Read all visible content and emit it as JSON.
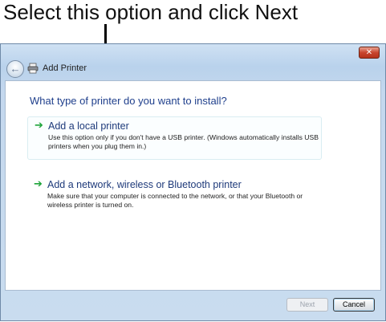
{
  "caption": "Select this option and click Next",
  "window": {
    "title": "Add Printer",
    "icons": {
      "back": "back-arrow-icon",
      "printer": "printer-icon",
      "close": "close-icon"
    }
  },
  "content": {
    "heading": "What type of printer do you want to install?",
    "options": [
      {
        "title": "Add a local printer",
        "description": "Use this option only if you don't have a USB printer. (Windows automatically installs USB printers when you plug them in.)",
        "icon": "green-arrow-icon"
      },
      {
        "title": "Add a network, wireless or Bluetooth printer",
        "description": "Make sure that your computer is connected to the network, or that your Bluetooth or wireless printer is turned on.",
        "icon": "green-arrow-icon"
      }
    ]
  },
  "buttons": {
    "next": "Next",
    "cancel": "Cancel"
  }
}
